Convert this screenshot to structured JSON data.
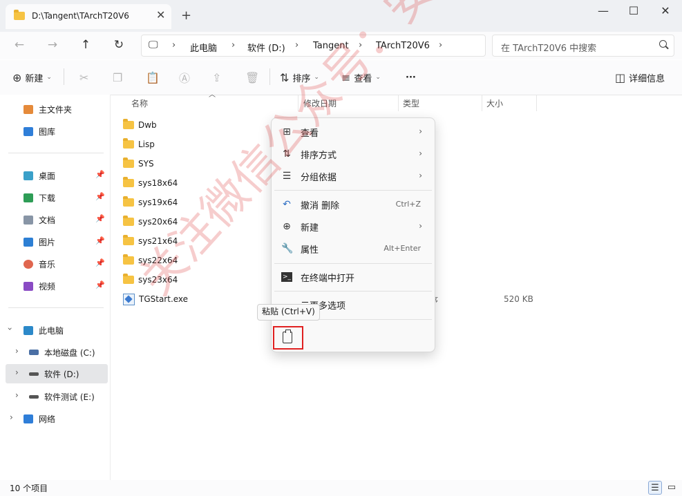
{
  "window": {
    "tab_title": "D:\\Tangent\\TArchT20V6",
    "close_tab": "✕",
    "new_tab": "+",
    "minimize": "—",
    "maximize": "☐",
    "close": "✕"
  },
  "nav": {
    "breadcrumbs": [
      "此电脑",
      "软件 (D:)",
      "Tangent",
      "TArchT20V6"
    ],
    "search_placeholder": "在 TArchT20V6 中搜索"
  },
  "toolbar": {
    "new_label": "新建",
    "sort_label": "排序",
    "view_label": "查看",
    "more_label": "···",
    "details_label": "详细信息"
  },
  "sidebar": {
    "quick": [
      {
        "label": "主文件夹",
        "icon": "home-icon"
      },
      {
        "label": "图库",
        "icon": "gallery-icon"
      }
    ],
    "pinned": [
      {
        "label": "桌面",
        "icon": "desktop-icon"
      },
      {
        "label": "下载",
        "icon": "download-icon"
      },
      {
        "label": "文档",
        "icon": "document-icon"
      },
      {
        "label": "图片",
        "icon": "pictures-icon"
      },
      {
        "label": "音乐",
        "icon": "music-icon"
      },
      {
        "label": "视频",
        "icon": "video-icon"
      }
    ],
    "tree": [
      {
        "label": "此电脑",
        "icon": "pc-icon"
      },
      {
        "label": "本地磁盘 (C:)",
        "icon": "drive-icon"
      },
      {
        "label": "软件 (D:)",
        "icon": "drive-icon"
      },
      {
        "label": "软件测试 (E:)",
        "icon": "drive-icon"
      },
      {
        "label": "网络",
        "icon": "network-icon"
      }
    ]
  },
  "columns": {
    "name": "名称",
    "date": "修改日期",
    "type": "类型",
    "size": "大小"
  },
  "files": [
    {
      "name": "Dwb",
      "kind": "folder"
    },
    {
      "name": "Lisp",
      "kind": "folder"
    },
    {
      "name": "SYS",
      "kind": "folder"
    },
    {
      "name": "sys18x64",
      "kind": "folder"
    },
    {
      "name": "sys19x64",
      "kind": "folder"
    },
    {
      "name": "sys20x64",
      "kind": "folder"
    },
    {
      "name": "sys21x64",
      "kind": "folder"
    },
    {
      "name": "sys22x64",
      "kind": "folder"
    },
    {
      "name": "sys23x64",
      "kind": "folder"
    },
    {
      "name": "TGStart.exe",
      "kind": "exe",
      "type_fragment": "序",
      "size": "520 KB"
    }
  ],
  "context_menu": {
    "items": [
      {
        "label": "查看",
        "icon": "view-grid-icon",
        "submenu": true
      },
      {
        "label": "排序方式",
        "icon": "sort-icon",
        "submenu": true
      },
      {
        "label": "分组依据",
        "icon": "group-icon",
        "submenu": true
      },
      {
        "label": "撤消 删除",
        "icon": "undo-icon",
        "shortcut": "Ctrl+Z"
      },
      {
        "label": "新建",
        "icon": "plus-circle-icon",
        "submenu": true
      },
      {
        "label": "属性",
        "icon": "wrench-icon",
        "shortcut": "Alt+Enter"
      },
      {
        "label": "在终端中打开",
        "icon": "terminal-icon"
      },
      {
        "label": "示更多选项",
        "icon": "more-options-icon"
      }
    ],
    "paste_tooltip": "粘贴 (Ctrl+V)"
  },
  "status": {
    "item_count": "10 个项目"
  },
  "watermark": "关注微信公众号：安盾软件管家"
}
